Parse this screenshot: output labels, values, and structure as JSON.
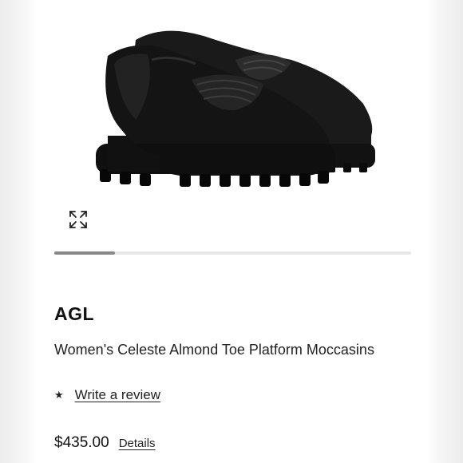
{
  "product": {
    "image_alt": "Black leather platform loafers with ruched vamp and lug sole",
    "brand": "AGL",
    "name": "Women's Celeste Almond Toe Platform Moccasins",
    "price": "$435.00",
    "details_label": "Details"
  },
  "review": {
    "star_icon": "★",
    "link_label": "Write a review"
  },
  "gallery": {
    "expand_icon": "expand-arrows-icon",
    "progress": 0.17
  }
}
